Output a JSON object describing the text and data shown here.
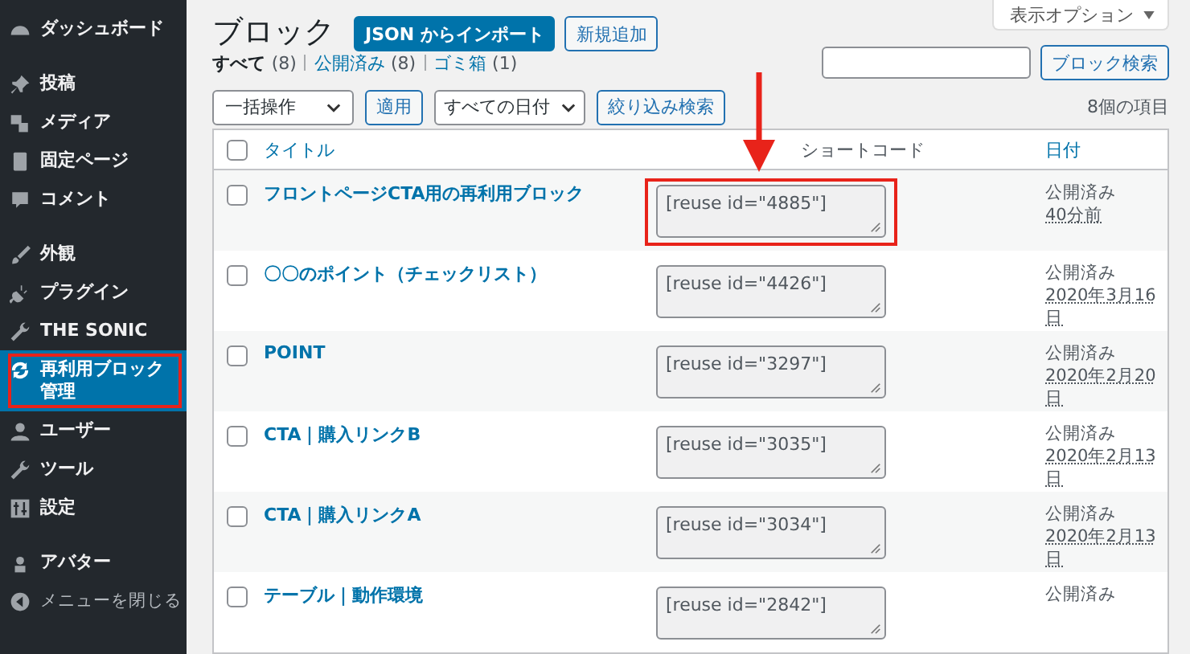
{
  "sidebar": {
    "groups": [
      {
        "items": [
          {
            "label": "ダッシュボード",
            "selected": false,
            "highlighted": false
          }
        ]
      },
      {
        "items": [
          {
            "label": "投稿",
            "selected": false,
            "highlighted": false
          },
          {
            "label": "メディア",
            "selected": false,
            "highlighted": false
          },
          {
            "label": "固定ページ",
            "selected": false,
            "highlighted": false
          },
          {
            "label": "コメント",
            "selected": false,
            "highlighted": false
          }
        ]
      },
      {
        "items": [
          {
            "label": "外観",
            "selected": false,
            "highlighted": false
          },
          {
            "label": "プラグイン",
            "selected": false,
            "highlighted": false
          },
          {
            "label": "THE SONIC",
            "selected": false,
            "highlighted": false
          },
          {
            "label": "再利用ブロック管理",
            "selected": true,
            "highlighted": true
          },
          {
            "label": "ユーザー",
            "selected": false,
            "highlighted": false
          },
          {
            "label": "ツール",
            "selected": false,
            "highlighted": false
          },
          {
            "label": "設定",
            "selected": false,
            "highlighted": false
          }
        ]
      },
      {
        "items": [
          {
            "label": "アバター",
            "selected": false,
            "highlighted": false
          },
          {
            "label": "メニューを閉じる",
            "selected": false,
            "highlighted": false
          }
        ]
      }
    ]
  },
  "page": {
    "title": "ブロック",
    "buttons": [
      {
        "label": "JSON からインポート",
        "kind": "primary"
      },
      {
        "label": "新規追加",
        "kind": "secondary"
      }
    ],
    "screen_options": "表示オプション"
  },
  "views": [
    {
      "label": "すべて",
      "count": "(8)",
      "selected": true
    },
    {
      "label": "公開済み",
      "count": "(8)",
      "selected": false
    },
    {
      "label": "ゴミ箱",
      "count": "(1)",
      "selected": false
    }
  ],
  "search": {
    "button": "ブロック検索"
  },
  "filters": {
    "bulk_action": "一括操作",
    "apply": "適用",
    "date": "すべての日付",
    "filter": "絞り込み検索"
  },
  "item_count": "8個の項目",
  "table": {
    "select_all_checked": false,
    "columns": [
      "タイトル",
      "ショートコード",
      "日付"
    ],
    "rows": [
      {
        "checked": false,
        "title": "フロントページCTA用の再利用ブロック",
        "shortcode": "[reuse id=\"4885\"]",
        "highlighted": true,
        "status": "公開済み",
        "date": "40分前"
      },
      {
        "checked": false,
        "title": "〇〇のポイント（チェックリスト）",
        "shortcode": "[reuse id=\"4426\"]",
        "highlighted": false,
        "status": "公開済み",
        "date": "2020年3月16日"
      },
      {
        "checked": false,
        "title": "POINT",
        "shortcode": "[reuse id=\"3297\"]",
        "highlighted": false,
        "status": "公開済み",
        "date": "2020年2月20日"
      },
      {
        "checked": false,
        "title": "CTA｜購入リンクB",
        "shortcode": "[reuse id=\"3035\"]",
        "highlighted": false,
        "status": "公開済み",
        "date": "2020年2月13日"
      },
      {
        "checked": false,
        "title": "CTA｜購入リンクA",
        "shortcode": "[reuse id=\"3034\"]",
        "highlighted": false,
        "status": "公開済み",
        "date": "2020年2月13日"
      },
      {
        "checked": false,
        "title": "テーブル｜動作環境",
        "shortcode": "[reuse id=\"2842\"]",
        "highlighted": false,
        "status": "公開済み"
      }
    ]
  }
}
